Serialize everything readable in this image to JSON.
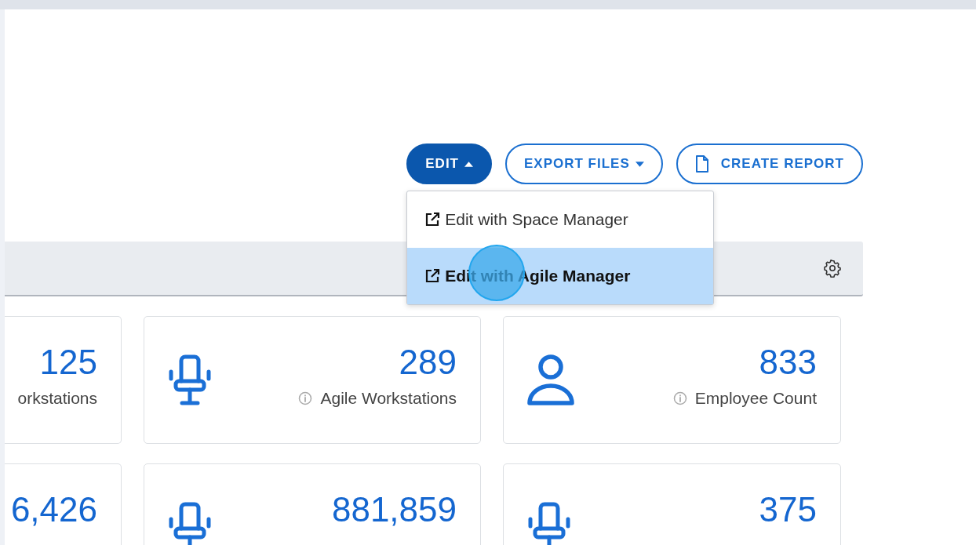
{
  "actions": [
    {
      "label": "EDIT",
      "kind": "dropdown",
      "primary": true,
      "expanded": true
    },
    {
      "label": "EXPORT FILES",
      "kind": "dropdown",
      "primary": false,
      "expanded": false
    },
    {
      "label": "CREATE REPORT",
      "kind": "document",
      "primary": false
    }
  ],
  "edit_menu": [
    {
      "label": "Edit with Space Manager",
      "selected": false
    },
    {
      "label": "Edit with Agile Manager",
      "selected": true
    }
  ],
  "click_indicator": true,
  "cards": [
    [
      {
        "value": "125",
        "label": "orkstations",
        "kind": "plain"
      },
      {
        "value": "289",
        "label": "Agile Workstations",
        "kind": "chair",
        "info": true
      },
      {
        "value": "833",
        "label": "Employee Count",
        "kind": "person",
        "info": true
      }
    ],
    [
      {
        "value": "6,426",
        "kind": "plain"
      },
      {
        "value": "881,859",
        "kind": "chair"
      },
      {
        "value": "375",
        "kind": "chair"
      }
    ]
  ]
}
